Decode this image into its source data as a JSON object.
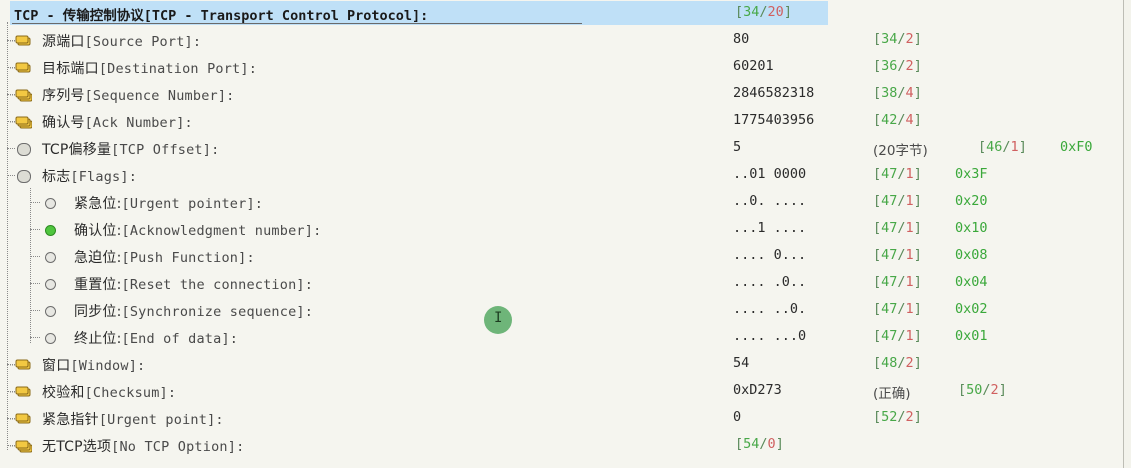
{
  "header": {
    "title": "TCP - 传输控制协议[TCP - Transport Control Protocol]:",
    "offset_a": "34",
    "offset_b": "20"
  },
  "rows": [
    {
      "cn": "源端口",
      "en": "[Source Port]:",
      "value": "80",
      "oa": "34",
      "ob": "2",
      "hex": ""
    },
    {
      "cn": "目标端口",
      "en": "[Destination Port]:",
      "value": "60201",
      "oa": "36",
      "ob": "2",
      "hex": ""
    },
    {
      "cn": "序列号",
      "en": "[Sequence Number]:",
      "value": "2846582318",
      "oa": "38",
      "ob": "4",
      "hex": ""
    },
    {
      "cn": "确认号",
      "en": "[Ack Number]:",
      "value": "1775403956",
      "oa": "42",
      "ob": "4",
      "hex": ""
    },
    {
      "cn": "TCP偏移量",
      "en": "[TCP Offset]:",
      "value": "5",
      "note": "(20字节)",
      "oa": "46",
      "ob": "1",
      "hex": "0xF0"
    },
    {
      "cn": "标志",
      "en": "[Flags]:",
      "value": "..01 0000",
      "oa": "47",
      "ob": "1",
      "hex": "0x3F"
    },
    {
      "cn": "紧急位:",
      "en": "[Urgent pointer]:",
      "value": "..0. ....",
      "oa": "47",
      "ob": "1",
      "hex": "0x20"
    },
    {
      "cn": "确认位:",
      "en": "[Acknowledgment number]:",
      "value": "...1 ....",
      "oa": "47",
      "ob": "1",
      "hex": "0x10"
    },
    {
      "cn": "急迫位:",
      "en": "[Push Function]:",
      "value": ".... 0...",
      "oa": "47",
      "ob": "1",
      "hex": "0x08"
    },
    {
      "cn": "重置位:",
      "en": "[Reset the connection]:",
      "value": ".... .0..",
      "oa": "47",
      "ob": "1",
      "hex": "0x04"
    },
    {
      "cn": "同步位:",
      "en": "[Synchronize sequence]:",
      "value": ".... ..0.",
      "oa": "47",
      "ob": "1",
      "hex": "0x02"
    },
    {
      "cn": "终止位:",
      "en": "[End of data]:",
      "value": ".... ...0",
      "oa": "47",
      "ob": "1",
      "hex": "0x01"
    },
    {
      "cn": "窗口",
      "en": "[Window]:",
      "value": "54",
      "oa": "48",
      "ob": "2",
      "hex": ""
    },
    {
      "cn": "校验和",
      "en": "[Checksum]:",
      "value": "0xD273",
      "note": "(正确)",
      "oa": "50",
      "ob": "2",
      "hex": ""
    },
    {
      "cn": "紧急指针",
      "en": "[Urgent point]:",
      "value": "0",
      "oa": "52",
      "ob": "2",
      "hex": ""
    },
    {
      "cn": "无TCP选项",
      "en": "[No TCP Option]:",
      "value": "",
      "oa": "54",
      "ob": "0",
      "hex": ""
    }
  ],
  "icons": {
    "field": "field-icon",
    "multi_byte": "multi-byte-field-icon",
    "group": "expander-icon",
    "flag_off": "flag-off-icon",
    "flag_on": "flag-on-icon"
  },
  "colors": {
    "header_highlight": "#bfe0f7",
    "offset_green": "#48a848",
    "offset_red": "#d06060",
    "hex_green": "#3aa83a",
    "flag_set": "#4fc53e"
  }
}
